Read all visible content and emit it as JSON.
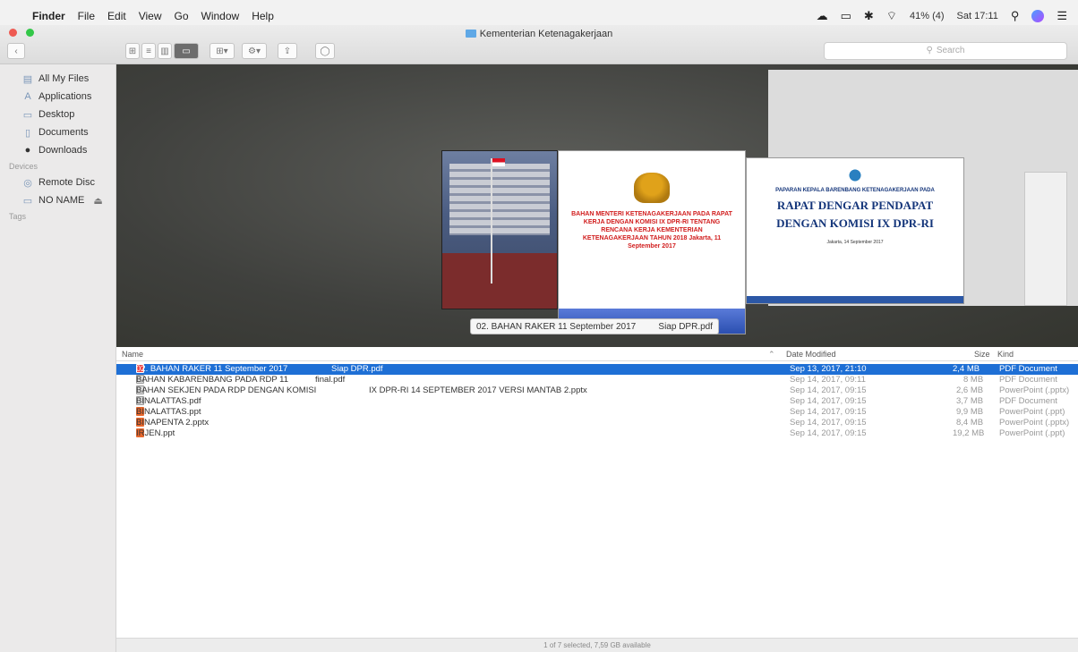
{
  "menubar": {
    "apple": "",
    "items": [
      "Finder",
      "File",
      "Edit",
      "View",
      "Go",
      "Window",
      "Help"
    ],
    "battery": "41% (4)",
    "clock": "Sat 17:11"
  },
  "window": {
    "title": "Kementerian Ketenagakerjaan",
    "search_placeholder": "Search"
  },
  "sidebar": {
    "favorites": [
      "All My Files",
      "Applications",
      "Desktop",
      "Documents",
      "Downloads"
    ],
    "devices_header": "Devices",
    "devices": [
      "Remote Disc",
      "NO NAME"
    ],
    "tags_header": "Tags"
  },
  "coverflow": {
    "caption_name": "02. BAHAN RAKER 11 September 2017",
    "caption_suffix": "Siap DPR.pdf",
    "doc1_text": "BAHAN MENTERI KETENAGAKERJAAN PADA RAPAT KERJA DENGAN KOMISI IX DPR-RI TENTANG RENCANA KERJA KEMENTERIAN KETENAGAKERJAAN TAHUN 2018 Jakarta, 11 September 2017",
    "doc2_small": "PAPARAN KEPALA BARENBANG KETENAGAKERJAAN PADA",
    "doc2_big1": "RAPAT DENGAR PENDAPAT",
    "doc2_big2": "DENGAN KOMISI IX DPR-RI",
    "doc2_date": "Jakarta, 14 September 2017"
  },
  "list": {
    "headers": {
      "name": "Name",
      "date": "Date Modified",
      "size": "Size",
      "kind": "Kind"
    },
    "rows": [
      {
        "name": "02. BAHAN RAKER 11 September 2017",
        "name_suffix": "Siap DPR.pdf",
        "date": "Sep 13, 2017, 21:10",
        "size": "2,4 MB",
        "kind": "PDF Document",
        "icon": "pdf-icon"
      },
      {
        "name": "BAHAN KABARENBANG PADA RDP 11",
        "name_suffix": "final.pdf",
        "date": "Sep 14, 2017, 09:11",
        "size": "8 MB",
        "kind": "PDF Document",
        "icon": "pdf-icon"
      },
      {
        "name": "BAHAN SEKJEN PADA RDP DENGAN KOMISI",
        "name_suffix": "IX DPR-RI 14 SEPTEMBER 2017 VERSI MANTAB 2.pptx",
        "date": "Sep 14, 2017, 09:15",
        "size": "2,6 MB",
        "kind": "PowerPoint (.pptx)",
        "icon": "pptx-icon"
      },
      {
        "name": "BINALATTAS.pdf",
        "name_suffix": "",
        "date": "Sep 14, 2017, 09:15",
        "size": "3,7 MB",
        "kind": "PDF Document",
        "icon": "pdf-icon"
      },
      {
        "name": "BINALATTAS.ppt",
        "name_suffix": "",
        "date": "Sep 14, 2017, 09:15",
        "size": "9,9 MB",
        "kind": "PowerPoint (.ppt)",
        "icon": "ppt-icon"
      },
      {
        "name": "BINAPENTA 2.pptx",
        "name_suffix": "",
        "date": "Sep 14, 2017, 09:15",
        "size": "8,4 MB",
        "kind": "PowerPoint (.pptx)",
        "icon": "pptx-icon"
      },
      {
        "name": "IRJEN.ppt",
        "name_suffix": "",
        "date": "Sep 14, 2017, 09:15",
        "size": "19,2 MB",
        "kind": "PowerPoint (.ppt)",
        "icon": "ppt-icon"
      }
    ]
  },
  "status": "1 of 7 selected, 7,59 GB available"
}
